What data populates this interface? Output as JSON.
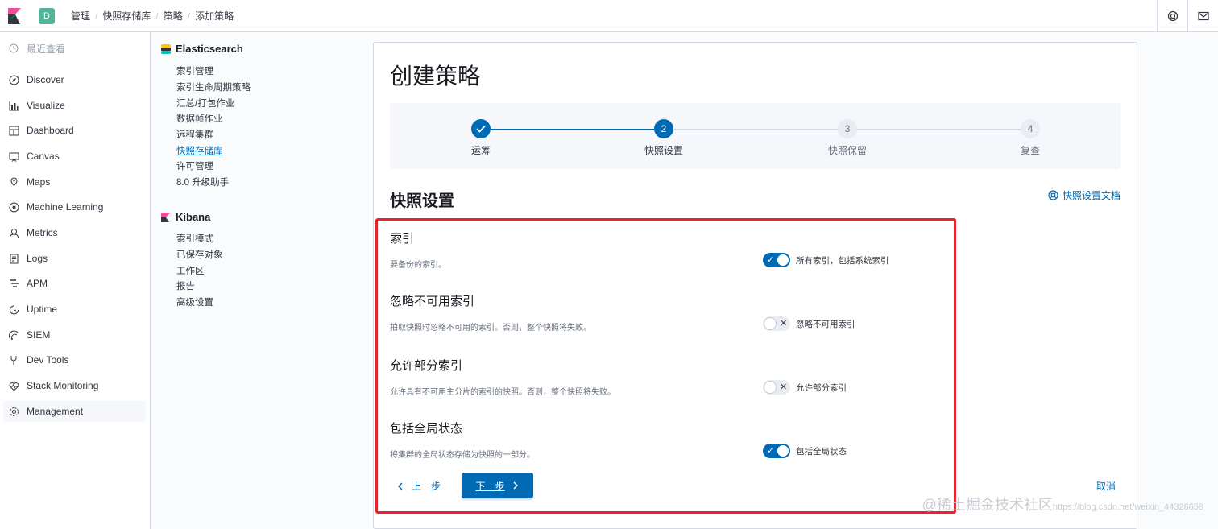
{
  "header": {
    "space_initial": "D",
    "breadcrumbs": [
      "管理",
      "快照存储库",
      "策略",
      "添加策略"
    ]
  },
  "nav": {
    "recent": "最近查看",
    "items": [
      "Discover",
      "Visualize",
      "Dashboard",
      "Canvas",
      "Maps",
      "Machine Learning",
      "Metrics",
      "Logs",
      "APM",
      "Uptime",
      "SIEM",
      "Dev Tools",
      "Stack Monitoring",
      "Management"
    ]
  },
  "mgmt": {
    "elasticsearch": {
      "title": "Elasticsearch",
      "links": [
        "索引管理",
        "索引生命周期策略",
        "汇总/打包作业",
        "数据帧作业",
        "远程集群",
        "快照存储库",
        "许可管理",
        "8.0 升级助手"
      ]
    },
    "kibana": {
      "title": "Kibana",
      "links": [
        "索引模式",
        "已保存对象",
        "工作区",
        "报告",
        "高级设置"
      ]
    }
  },
  "main": {
    "title": "创建策略",
    "steps": [
      {
        "label": "运筹",
        "number": "1",
        "state": "done"
      },
      {
        "label": "快照设置",
        "number": "2",
        "state": "current"
      },
      {
        "label": "快照保留",
        "number": "3",
        "state": "todo"
      },
      {
        "label": "复查",
        "number": "4",
        "state": "todo"
      }
    ],
    "section_title": "快照设置",
    "doc_link": "快照设置文档",
    "settings": [
      {
        "title": "索引",
        "desc": "要备份的索引。",
        "switch_label": "所有索引，包括系统索引",
        "on": true
      },
      {
        "title": "忽略不可用索引",
        "desc": "拍取快照时忽略不可用的索引。否则，整个快照将失败。",
        "switch_label": "忽略不可用索引",
        "on": false
      },
      {
        "title": "允许部分索引",
        "desc": "允许具有不可用主分片的索引的快照。否则，整个快照将失败。",
        "switch_label": "允许部分索引",
        "on": false
      },
      {
        "title": "包括全局状态",
        "desc": "将集群的全局状态存储为快照的一部分。",
        "switch_label": "包括全局状态",
        "on": true
      }
    ],
    "back_label": "上一步",
    "next_label": "下一步",
    "cancel_label": "取消"
  },
  "watermark": {
    "main": "@稀土掘金技术社区",
    "sub": "https://blog.csdn.net/weixin_44326658"
  },
  "colors": {
    "primary": "#006bb4",
    "highlight": "#e8232c",
    "switch_off": "#e9edf3"
  }
}
